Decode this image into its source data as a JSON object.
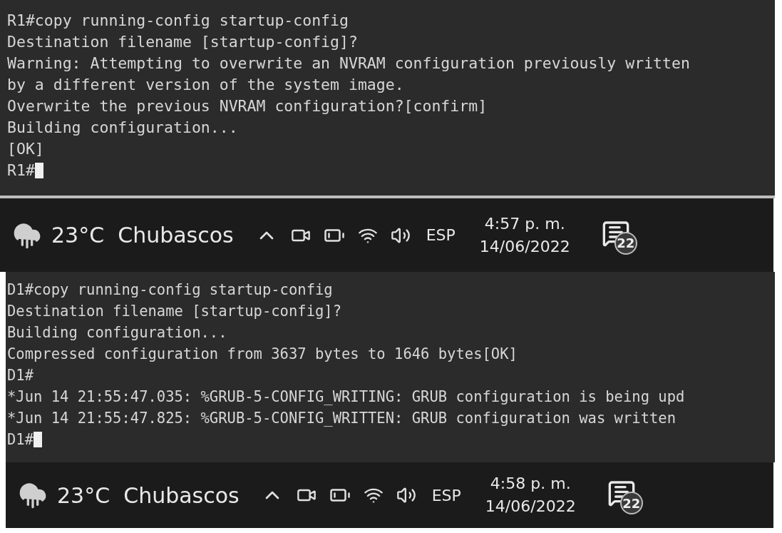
{
  "screenshots": [
    {
      "terminal": {
        "lines": [
          "R1#copy running-config startup-config",
          "Destination filename [startup-config]?",
          "Warning: Attempting to overwrite an NVRAM configuration previously written",
          "by a different version of the system image.",
          "Overwrite the previous NVRAM configuration?[confirm]",
          "Building configuration...",
          "[OK]"
        ],
        "prompt": "R1#"
      },
      "taskbar": {
        "weather": "23°C  Chubascos",
        "language": "ESP",
        "time": "4:57 p. m.",
        "date": "14/06/2022",
        "notifications": "22"
      }
    },
    {
      "terminal": {
        "lines": [
          "D1#copy running-config startup-config",
          "Destination filename [startup-config]?",
          "Building configuration...",
          "Compressed configuration from 3637 bytes to 1646 bytes[OK]",
          "D1#",
          "*Jun 14 21:55:47.035: %GRUB-5-CONFIG_WRITING: GRUB configuration is being upd",
          "*Jun 14 21:55:47.825: %GRUB-5-CONFIG_WRITTEN: GRUB configuration was written"
        ],
        "prompt": "D1#"
      },
      "taskbar": {
        "weather": "23°C  Chubascos",
        "language": "ESP",
        "time": "4:58 p. m.",
        "date": "14/06/2022",
        "notifications": "22"
      }
    }
  ]
}
